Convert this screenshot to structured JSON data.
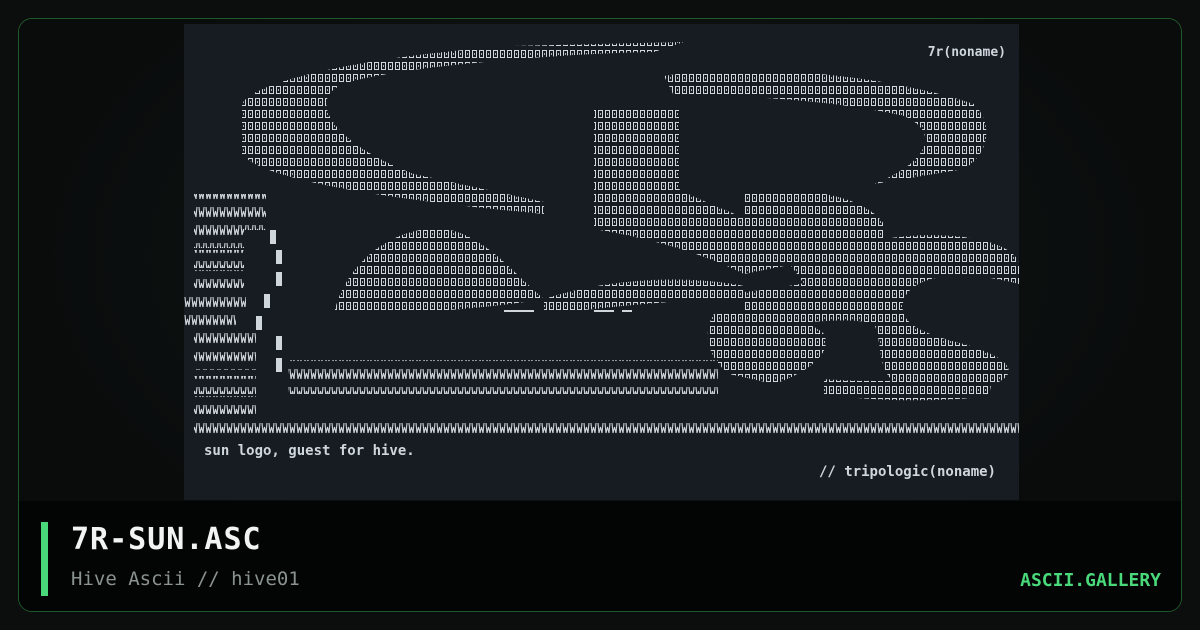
{
  "artwork": {
    "lines": [
      {
        "text": "7r(noname)"
      },
      {
        "text": "sun logo, guest for hive."
      },
      {
        "text": "// tripologic(noname)"
      }
    ]
  },
  "footer": {
    "title": "7R-SUN.ASC",
    "subtitle": "Hive Ascii // hive01",
    "brand": "ASCII.GALLERY"
  },
  "colors": {
    "accent": "#49d97a",
    "border": "#1f5a2a",
    "art_background": "#171c22",
    "art_foreground": "#cfd6dc",
    "footer_background": "#030404"
  }
}
